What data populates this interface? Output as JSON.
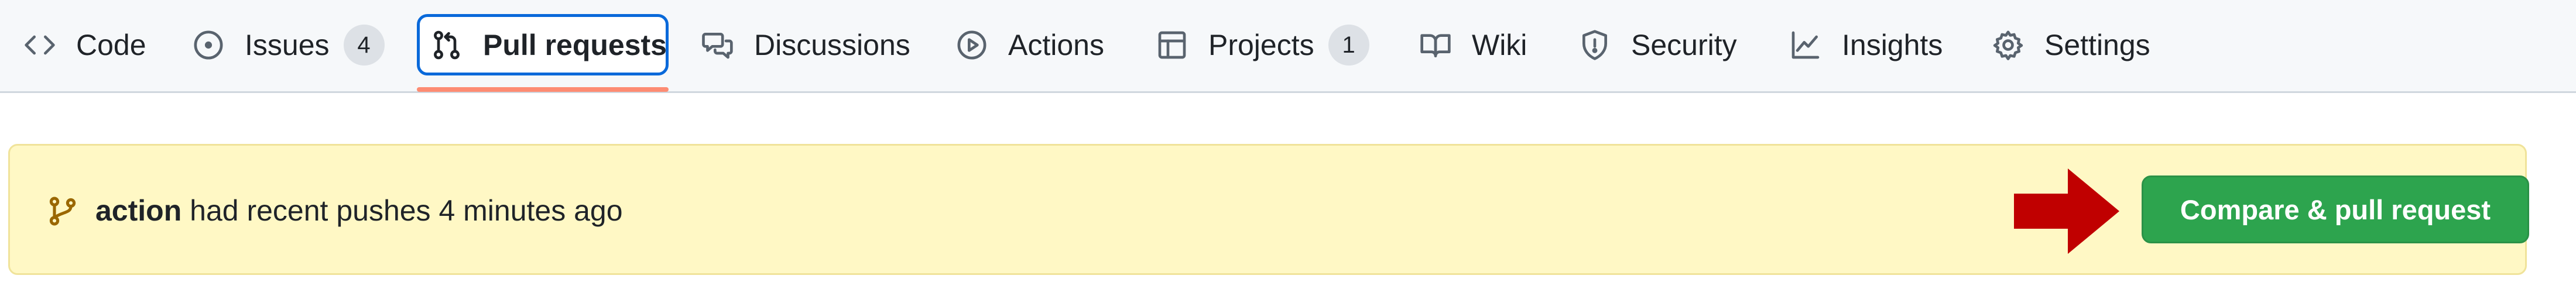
{
  "nav": {
    "items": [
      {
        "label": "Code",
        "icon": "code-icon"
      },
      {
        "label": "Issues",
        "icon": "issue-icon",
        "count": "4"
      },
      {
        "label": "Pull requests",
        "icon": "pull-request-icon",
        "selected": true
      },
      {
        "label": "Discussions",
        "icon": "discussions-icon"
      },
      {
        "label": "Actions",
        "icon": "play-icon"
      },
      {
        "label": "Projects",
        "icon": "table-icon",
        "count": "1"
      },
      {
        "label": "Wiki",
        "icon": "book-icon"
      },
      {
        "label": "Security",
        "icon": "shield-icon"
      },
      {
        "label": "Insights",
        "icon": "graph-icon"
      },
      {
        "label": "Settings",
        "icon": "gear-icon"
      }
    ]
  },
  "banner": {
    "branch": "action",
    "message": "had recent pushes 4 minutes ago",
    "button_label": "Compare & pull request",
    "icon": "git-branch-icon",
    "annotation": "red-arrow-icon"
  },
  "colors": {
    "nav_background": "#f6f8fa",
    "selected_border": "#0969da",
    "selected_underline": "#fd8c73",
    "banner_background": "#fff8c5",
    "button_green": "#2da44e",
    "arrow_red": "#c00000"
  }
}
